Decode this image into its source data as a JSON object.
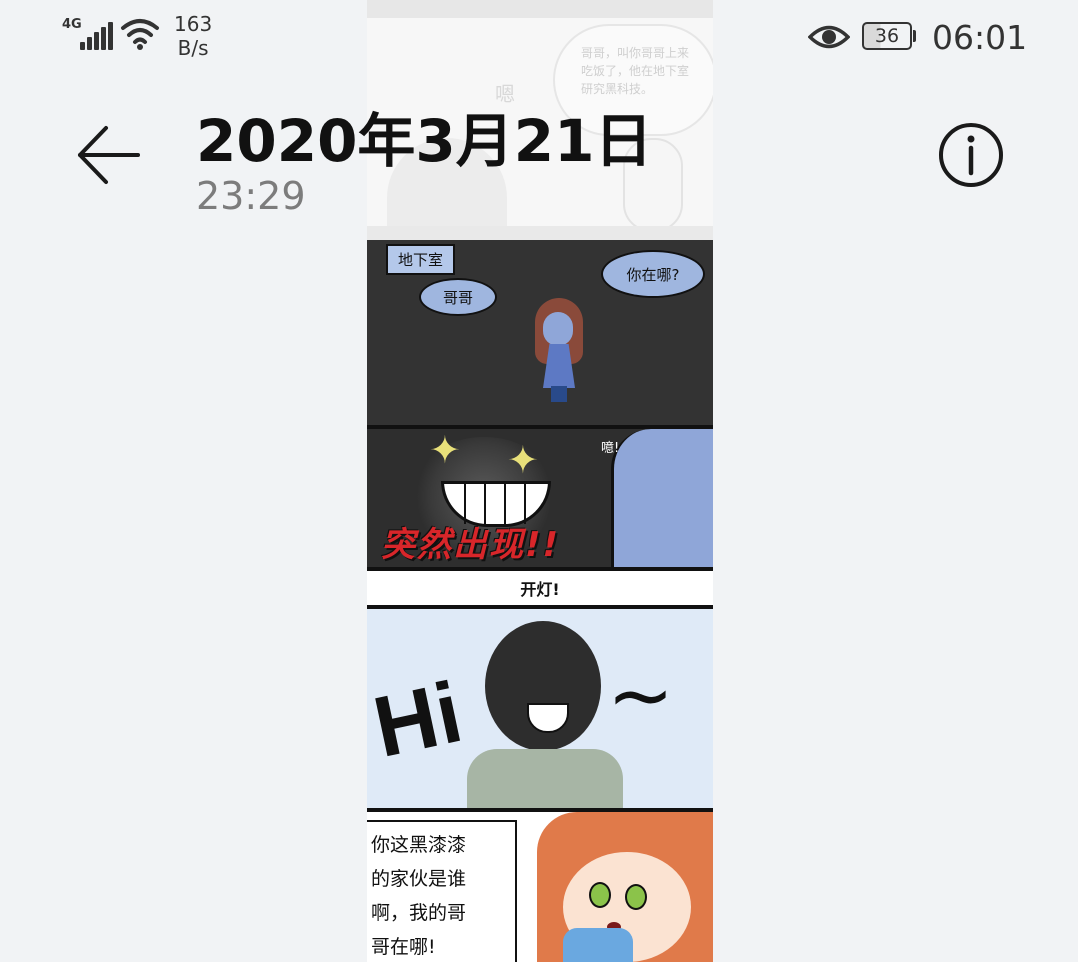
{
  "status_bar": {
    "network_type": "4G",
    "speed_value": "163",
    "speed_unit": "B/s",
    "battery_level": "36",
    "time": "06:01"
  },
  "header": {
    "title": "2020年3月21日",
    "subtitle": "23:29",
    "back_icon": "back-arrow-icon",
    "info_icon": "info-icon"
  },
  "comic": {
    "prev_panel_text": "哥哥，叫你哥哥上来吃饭了，他在地下室研究黑科技。",
    "prev_panel_sfx": "嗯",
    "panel1": {
      "place": "地下室",
      "bubble_call": "哥哥",
      "bubble_where": "你在哪?"
    },
    "panel2": {
      "sfx": "噫!",
      "caption": "突然出现!!"
    },
    "panel3": {
      "caption": "开灯!"
    },
    "panel4": {
      "text": "Hi",
      "tilde": "~"
    },
    "panel5": {
      "line1": "你这黑漆漆",
      "line2": "的家伙是谁",
      "line3": "啊，我的哥",
      "line4": "哥在哪!"
    }
  },
  "colors": {
    "background": "#f1f3f5",
    "text_primary": "#111111",
    "text_secondary": "#7c7c7c",
    "accent_red": "#d8262a"
  }
}
